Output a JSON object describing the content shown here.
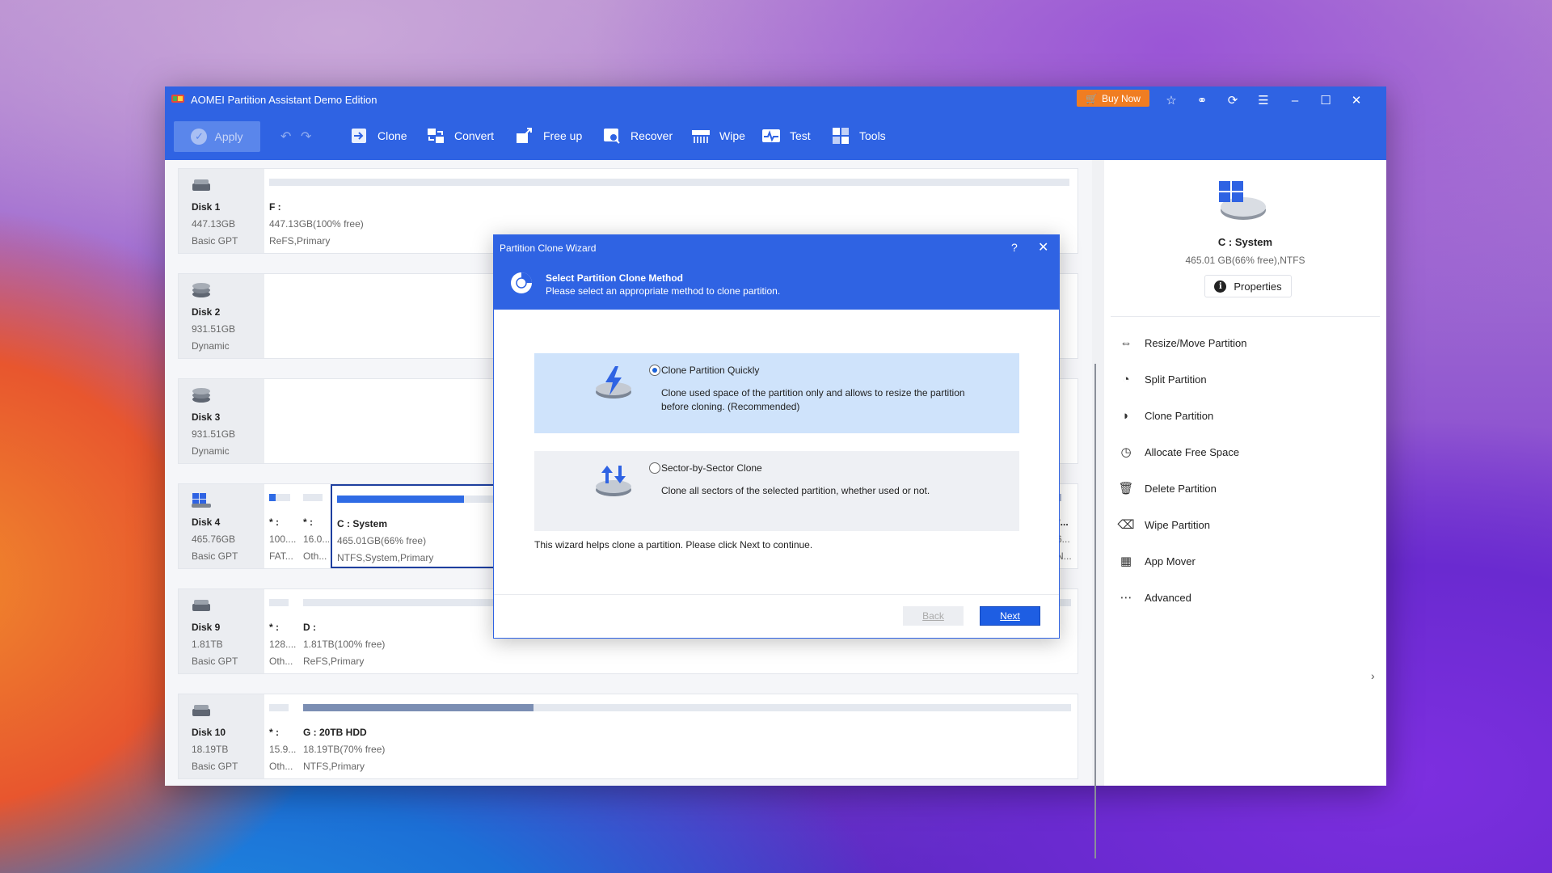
{
  "window": {
    "title": "AOMEI Partition Assistant Demo Edition",
    "buy_now": "Buy Now"
  },
  "toolbar": {
    "apply": "Apply",
    "tools": [
      {
        "label": "Clone",
        "icon": "clone-icon"
      },
      {
        "label": "Convert",
        "icon": "convert-icon"
      },
      {
        "label": "Free up",
        "icon": "free-up-icon"
      },
      {
        "label": "Recover",
        "icon": "recover-icon"
      },
      {
        "label": "Wipe",
        "icon": "wipe-icon"
      },
      {
        "label": "Test",
        "icon": "test-icon"
      },
      {
        "label": "Tools",
        "icon": "tools-icon"
      }
    ]
  },
  "disks": [
    {
      "name": "Disk 1",
      "size": "447.13GB",
      "type": "Basic GPT",
      "partitions": [
        {
          "name": "F :",
          "info": "447.13GB(100% free)",
          "type": "ReFS,Primary"
        }
      ]
    },
    {
      "name": "Disk 2",
      "size": "931.51GB",
      "type": "Dynamic",
      "partitions": []
    },
    {
      "name": "Disk 3",
      "size": "931.51GB",
      "type": "Dynamic",
      "partitions": []
    },
    {
      "name": "Disk 4",
      "size": "465.76GB",
      "type": "Basic GPT",
      "partitions": [
        {
          "name": "* :",
          "info": "100....",
          "type": "FAT..."
        },
        {
          "name": "* :",
          "info": "16.0...",
          "type": "Oth..."
        },
        {
          "name": "C : System",
          "info": "465.01GB(66% free)",
          "type": "NTFS,System,Primary",
          "used": 0.34
        },
        {
          "name": "*...",
          "info": "6...",
          "type": "N..."
        }
      ]
    },
    {
      "name": "Disk 9",
      "size": "1.81TB",
      "type": "Basic GPT",
      "partitions": [
        {
          "name": "* :",
          "info": "128....",
          "type": "Oth..."
        },
        {
          "name": "D :",
          "info": "1.81TB(100% free)",
          "type": "ReFS,Primary"
        }
      ]
    },
    {
      "name": "Disk 10",
      "size": "18.19TB",
      "type": "Basic GPT",
      "partitions": [
        {
          "name": "* :",
          "info": "15.9...",
          "type": "Oth..."
        },
        {
          "name": "G : 20TB HDD",
          "info": "18.19TB(70% free)",
          "type": "NTFS,Primary",
          "used": 0.3
        }
      ]
    }
  ],
  "sidebar": {
    "title": "C : System",
    "subtitle": "465.01 GB(66% free),NTFS",
    "properties": "Properties",
    "items": [
      {
        "label": "Resize/Move Partition",
        "icon": "resize-icon"
      },
      {
        "label": "Split Partition",
        "icon": "split-icon"
      },
      {
        "label": "Clone Partition",
        "icon": "clone-partition-icon"
      },
      {
        "label": "Allocate Free Space",
        "icon": "allocate-icon"
      },
      {
        "label": "Delete Partition",
        "icon": "trash-icon"
      },
      {
        "label": "Wipe Partition",
        "icon": "eraser-icon"
      },
      {
        "label": "App Mover",
        "icon": "app-mover-icon"
      },
      {
        "label": "Advanced",
        "icon": "more-icon"
      }
    ]
  },
  "dialog": {
    "title": "Partition Clone Wizard",
    "heading": "Select Partition Clone Method",
    "subheading": "Please select an appropriate method to clone partition.",
    "options": [
      {
        "title": "Clone Partition Quickly",
        "desc": "Clone used space of the partition only and allows to resize the partition before cloning. (Recommended)",
        "selected": true
      },
      {
        "title": "Sector-by-Sector Clone",
        "desc": "Clone all sectors of the selected partition, whether used or not.",
        "selected": false
      }
    ],
    "hint": "This wizard helps clone a partition. Please click Next to continue.",
    "back": "Back",
    "next": "Next"
  },
  "colors": {
    "accent": "#2f63e3",
    "buy": "#f07d22",
    "selected_option": "#cfe3fb"
  }
}
